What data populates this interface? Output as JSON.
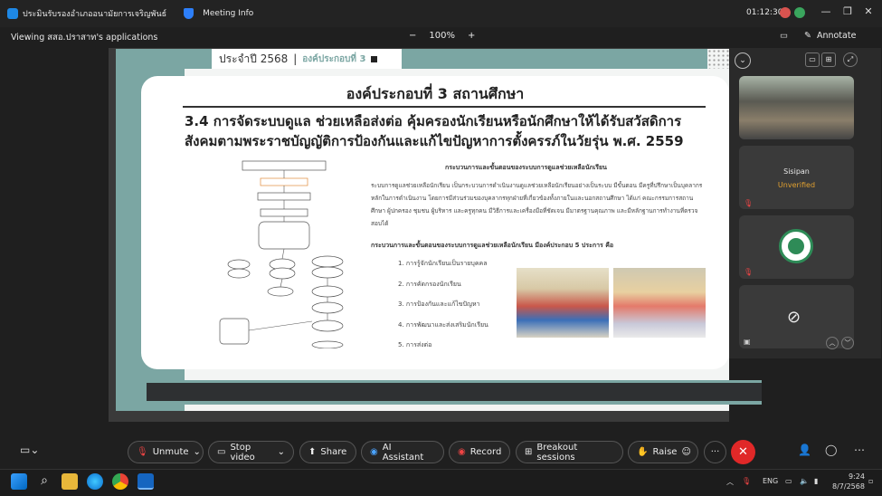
{
  "titlebar": {
    "title": "ประมินรับรองอำเภออนามัยการเจริญพันธ์",
    "meeting_info": "Meeting Info",
    "timer": "01:12:30"
  },
  "share": {
    "viewing": "Viewing สสอ.ปราสาท's applications",
    "zoom": "100%",
    "zoom_out": "−",
    "zoom_in": "+",
    "annotate": "Annotate"
  },
  "slide": {
    "tab_year": "ประจำปี 2568",
    "tab_component": "องค์ประกอบที่ 3",
    "title": "องค์ประกอบที่ 3 สถานศึกษา",
    "heading": "3.4 การจัดระบบดูแล ช่วยเหลือส่งต่อ คุ้มครองนักเรียนหรือนักศึกษาให้ได้รับสวัสดิการสังคมตามพระราชบัญญัติการป้องกันและแก้ไขปัญหาการตั้งครรภ์ในวัยรุ่น พ.ศ. 2559",
    "sub1": "กระบวนการและขั้นตอนของระบบการดูแลช่วยเหลือนักเรียน",
    "paragraph": "ระบบการดูแลช่วยเหลือนักเรียน เป็นกระบวนการดำเนินงานดูแลช่วยเหลือนักเรียนอย่างเป็นระบบ มีขั้นตอน มีครูที่ปรึกษาเป็นบุคลากรหลักในการดำเนินงาน โดยการมีส่วนร่วมของบุคลากรทุกฝ่ายที่เกี่ยวข้องทั้งภายในและนอกสถานศึกษา ได้แก่ คณะกรรมการสถานศึกษา ผู้ปกครอง ชุมชน ผู้บริหาร และครูทุกคน มีวิธีการและเครื่องมือที่ชัดเจน มีมาตรฐานคุณภาพ และมีหลักฐานการทำงานที่ตรวจสอบได้",
    "sub2": "กระบวนการและขั้นตอนของระบบการดูแลช่วยเหลือนักเรียน มีองค์ประกอบ 5 ประการ คือ",
    "items": [
      "1. การรู้จักนักเรียนเป็นรายบุคคล",
      "2. การคัดกรองนักเรียน",
      "3. การป้องกันและแก้ไขปัญหา",
      "4. การพัฒนาและส่งเสริมนักเรียน",
      "5. การส่งต่อ"
    ]
  },
  "participants": [
    {
      "name": "Sisipan",
      "status": "Unverified"
    }
  ],
  "toolbar": {
    "unmute": "Unmute",
    "stop_video": "Stop video",
    "share": "Share",
    "ai": "AI Assistant",
    "record": "Record",
    "breakout": "Breakout sessions",
    "raise": "Raise",
    "more": "···"
  },
  "taskbar": {
    "lang": "ENG",
    "time": "9:24",
    "date": "8/7/2568"
  }
}
